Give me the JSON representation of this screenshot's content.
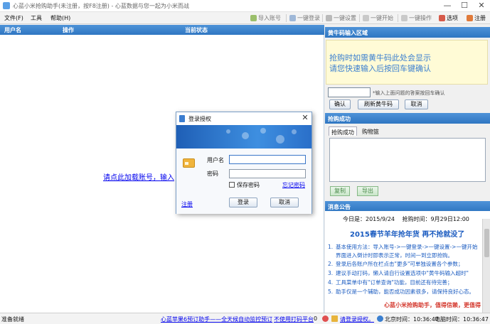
{
  "window": {
    "title": "心蓝小米抢购助手(未注册，按F8注册) - 心蓝数据与您一起为小米而战",
    "controls": {
      "minimize": "—",
      "maximize": "☐",
      "close": "✕"
    }
  },
  "menu": {
    "file": "文件(F)",
    "tools": "工具",
    "help": "帮助(H)"
  },
  "toolbar": {
    "import_accounts": "导入账号",
    "one_click_login": "一键登录",
    "one_click_settings": "一键设置",
    "one_click_start": "一键开始",
    "one_click_action": "一键操作",
    "options": "选项",
    "register": "注册"
  },
  "table": {
    "columns": [
      "用户名",
      "操作",
      "当前状态"
    ],
    "hint": "请点此加载账号，输入"
  },
  "captcha_panel": {
    "header": "黄牛码输入区域",
    "line1": "抢购时如需黄牛码此处会显示",
    "line2": "请您快速输入后按回车键确认",
    "note": "*输入上面问题的答案按回车确认",
    "confirm": "确认",
    "refresh": "刷新黄牛码",
    "cancel": "取消"
  },
  "success_panel": {
    "header": "抢购成功",
    "tabs": [
      "抢购成功",
      "购物篮"
    ],
    "copy": "复制",
    "export": "导出"
  },
  "notice_panel": {
    "header": "消息公告",
    "date": "今日是：2015/9/24　 抢购时间：9月29日12:00",
    "title": "2015春节羊年抢年货 再不抢就没了",
    "lines": [
      {
        "num": "1.",
        "text": "基本使用方法：导入账号->一键登录->一键设置->一键开始"
      },
      {
        "num": "",
        "text": "界面进入倒计时即表示正常，时间一到立即抢购。"
      },
      {
        "num": "2.",
        "text": "登录后各账户所在栏点击\"更多\"可单独设置各个参数；"
      },
      {
        "num": "3.",
        "text": "建议手动打码，懒人请自行设置选项中\"黄牛码输入超时\""
      },
      {
        "num": "4.",
        "text": "工具菜单中有\"订单查询\"功能，目前还有待完善；"
      },
      {
        "num": "5.",
        "text": "助手仅是一个辅助，能否成功因素很多，请保持良好心态。"
      }
    ],
    "footer": "心蓝小米抢购助手，值得信赖，更值得"
  },
  "statusbar": {
    "ready": "准备就绪",
    "promo": "心蓝苹果6预订助手——全天候自动监控预订",
    "nonuse": "不使用打码平台",
    "count": "0",
    "auth": "请登录授权。",
    "beijing_time": "北京时间：10:36:47",
    "pc_time": "电脑时间：10:36:47"
  },
  "dialog": {
    "title": "登录授权",
    "close": "✕",
    "username_label": "用户名",
    "password_label": "密码",
    "remember": "保存密码",
    "forgot": "忘记密码",
    "register": "注册",
    "login": "登录",
    "cancel": "取消"
  }
}
